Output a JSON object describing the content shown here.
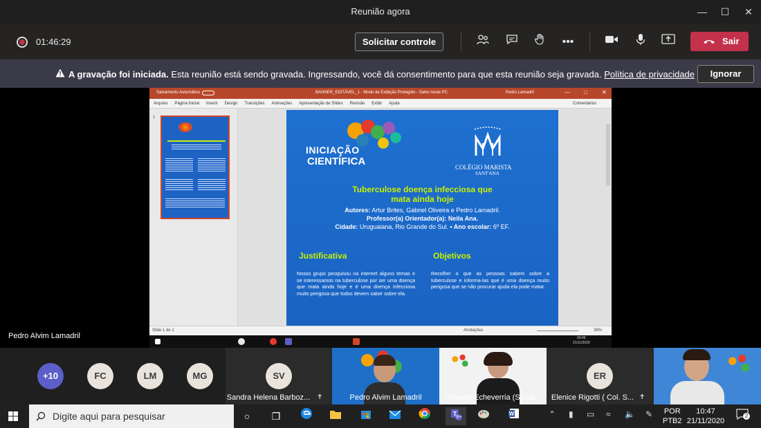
{
  "window": {
    "title": "Reunião agora"
  },
  "toolbar": {
    "elapsed": "01:46:29",
    "request_control": "Solicitar controle",
    "leave": "Sair"
  },
  "banner": {
    "bold": "A gravação foi iniciada.",
    "message": " Esta reunião está sendo gravada. Ingressando, você dá consentimento para que esta reunião seja gravada. ",
    "link": "Política de privacidade",
    "dismiss": "Ignorar"
  },
  "shared_screen": {
    "ppt": {
      "autosave": "Salvamento Automático",
      "doc_title": "BANNER_EDITÁVEL_1 - Modo de Exibição Protegido - Salvo neste PC",
      "user": "Pedro Lamadril",
      "menu": [
        "Arquivo",
        "Página Inicial",
        "Inserir",
        "Design",
        "Transições",
        "Animações",
        "Apresentação de Slides",
        "Revisão",
        "Exibir",
        "Ajuda"
      ],
      "comments": "Comentários",
      "status_left": "Slide 1 de 1",
      "status_notes": "Anotações",
      "zoom": "38%",
      "thumb_index": "1",
      "inner_time": "09:46",
      "inner_date": "21/11/2020"
    },
    "slide": {
      "logo_left_1": "INICIAÇÃO",
      "logo_left_2": "CIENTÍFICA",
      "logo_right_1": "COLÉGIO MARISTA",
      "logo_right_2": "SANT'ANA",
      "title_1": "Tuberculose doença infecciosa que",
      "title_2": "mata ainda hoje",
      "authors_label": "Autores:",
      "authors": " Artur Brites, Gabriel Oliveira e Pedro Lamadril.",
      "advisor_label": "Professor(a) Orientador(a):",
      "advisor": " Neila Ana.",
      "city_label": "Cidade:",
      "city": " Uruguaiana, Rio Grande do Sul.",
      "year_label": " • Ano escolar:",
      "year": " 6º EF.",
      "just_heading": "Justificativa",
      "just_text": "Nosso grupo pesquisou na internet alguns temas e se interessamos na tuberculose por ser uma doença que mata ainda hoje e é uma doença infecciosa muito perigosa que todos devem saber sobre ela.",
      "obj_heading": "Objetivos",
      "obj_text": "Recolher o que as pessoas sabem sobre a tuberculose e informa-las que é uma doença muito perigosa que se não procurar ajuda ela pode matar."
    },
    "presenter": "Pedro Alvim Lamadril"
  },
  "participants": {
    "more": "+10",
    "avatars": [
      "FC",
      "LM",
      "MG"
    ],
    "tiles": [
      {
        "initials": "SV",
        "name": "Sandra Helena Barboz..."
      },
      {
        "name": "Pedro Alvim Lamadril"
      },
      {
        "name": "Djiovani Echeverria (Santa..."
      },
      {
        "initials": "ER",
        "name": "Elenice Rigotti ( Col. S..."
      }
    ]
  },
  "taskbar": {
    "search_placeholder": "Digite aqui para pesquisar",
    "teams_badge": "9+",
    "lang_1": "POR",
    "lang_2": "PTB2",
    "time": "10:47",
    "date": "21/11/2020",
    "notifications": "2"
  },
  "colors": {
    "accent_red": "#c4314b",
    "slide_blue": "#1e70d0",
    "slide_title": "#c8f000",
    "banner": "#3b3a48"
  }
}
